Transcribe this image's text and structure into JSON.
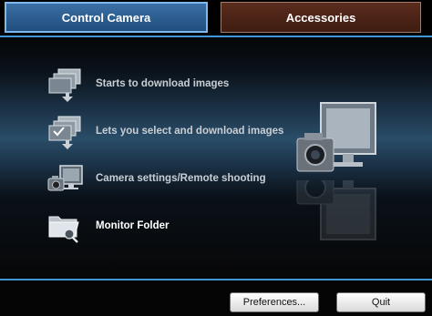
{
  "tabs": [
    {
      "label": "Control Camera",
      "selected": true
    },
    {
      "label": "Accessories",
      "selected": false
    }
  ],
  "menu": [
    {
      "label": "Starts to download images",
      "icon": "download-images-icon"
    },
    {
      "label": "Lets you select and download images",
      "icon": "select-download-icon"
    },
    {
      "label": "Camera settings/Remote shooting",
      "icon": "camera-computer-icon"
    },
    {
      "label": "Monitor Folder",
      "icon": "monitor-folder-icon"
    }
  ],
  "buttons": {
    "preferences": "Preferences...",
    "quit": "Quit"
  },
  "colors": {
    "accent_line": "#3f97d6",
    "tab_selected": "#2a5a8c",
    "tab_unselected": "#4a2417"
  }
}
